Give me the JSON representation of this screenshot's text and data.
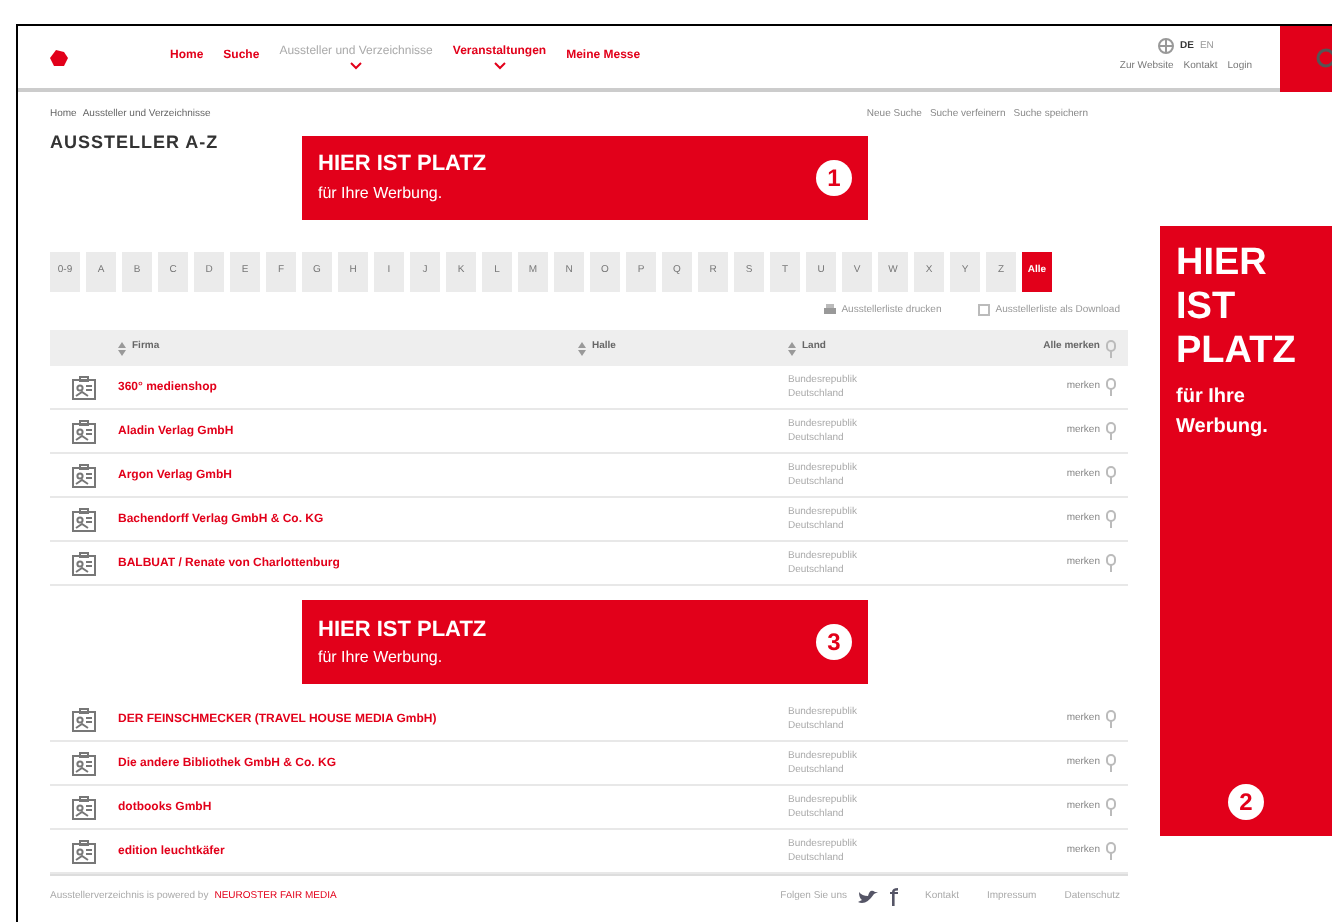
{
  "header": {
    "nav": [
      {
        "label": "Home",
        "selected": false,
        "dropdown": false
      },
      {
        "label": "Suche",
        "selected": false,
        "dropdown": false
      },
      {
        "label": "Aussteller und Verzeichnisse",
        "selected": true,
        "dropdown": true
      },
      {
        "label": "Veranstaltungen",
        "selected": false,
        "dropdown": true
      },
      {
        "label": "Meine Messe",
        "selected": false,
        "dropdown": false
      }
    ],
    "languages": [
      {
        "label": "DE",
        "selected": true
      },
      {
        "label": "EN",
        "selected": false
      }
    ],
    "links": [
      "Zur Website",
      "Kontakt",
      "Login"
    ]
  },
  "breadcrumb": [
    "Home",
    "Aussteller und Verzeichnisse"
  ],
  "search_links": [
    "Neue Suche",
    "Suche verfeinern",
    "Suche speichern"
  ],
  "title": "AUSSTELLER A-Z",
  "ads": [
    {
      "headline": "HIER IST PLATZ",
      "sub": "für Ihre Werbung.",
      "number": "1"
    },
    {
      "headline": "HIER IST PLATZ",
      "sub": "für Ihre Werbung.",
      "number": "2"
    }
  ],
  "letters": [
    {
      "label": "0-9",
      "selected": false
    },
    {
      "label": "A",
      "selected": false
    },
    {
      "label": "B",
      "selected": false
    },
    {
      "label": "C",
      "selected": false
    },
    {
      "label": "D",
      "selected": false
    },
    {
      "label": "E",
      "selected": false
    },
    {
      "label": "F",
      "selected": false
    },
    {
      "label": "G",
      "selected": false
    },
    {
      "label": "H",
      "selected": false
    },
    {
      "label": "I",
      "selected": false
    },
    {
      "label": "J",
      "selected": false
    },
    {
      "label": "K",
      "selected": false
    },
    {
      "label": "L",
      "selected": false
    },
    {
      "label": "M",
      "selected": false
    },
    {
      "label": "N",
      "selected": false
    },
    {
      "label": "O",
      "selected": false
    },
    {
      "label": "P",
      "selected": false
    },
    {
      "label": "Q",
      "selected": false
    },
    {
      "label": "R",
      "selected": false
    },
    {
      "label": "S",
      "selected": false
    },
    {
      "label": "T",
      "selected": false
    },
    {
      "label": "U",
      "selected": false
    },
    {
      "label": "V",
      "selected": false
    },
    {
      "label": "W",
      "selected": false
    },
    {
      "label": "X",
      "selected": false
    },
    {
      "label": "Y",
      "selected": false
    },
    {
      "label": "Z",
      "selected": false
    },
    {
      "label": "Alle",
      "selected": true
    }
  ],
  "options": {
    "print": "Ausstellerliste drucken",
    "checkbox": {
      "label": "Ausstellerliste als Download",
      "checked": false
    }
  },
  "table": {
    "columns": [
      "Firma",
      "Halle",
      "Land",
      "Alle merken"
    ],
    "rows": [
      {
        "kind": "row",
        "firma": "360° medienshop",
        "land": "Bundesrepublik Deutschland",
        "action": "merken"
      },
      {
        "kind": "row",
        "firma": "Aladin Verlag GmbH",
        "land": "Bundesrepublik Deutschland",
        "action": "merken"
      },
      {
        "kind": "row",
        "firma": "Argon Verlag GmbH",
        "land": "Bundesrepublik Deutschland",
        "action": "merken"
      },
      {
        "kind": "row",
        "firma": "Bachendorff Verlag GmbH & Co. KG",
        "land": "Bundesrepublik Deutschland",
        "action": "merken"
      },
      {
        "kind": "row",
        "firma": "BALBUAT / Renate von Charlottenburg",
        "land": "Bundesrepublik Deutschland",
        "action": "merken"
      },
      {
        "kind": "ad",
        "headline": "HIER IST PLATZ",
        "sub": "für Ihre Werbung.",
        "number": "3"
      },
      {
        "kind": "row",
        "firma": "DER FEINSCHMECKER (TRAVEL HOUSE MEDIA GmbH)",
        "land": "Bundesrepublik Deutschland",
        "action": "merken"
      },
      {
        "kind": "row",
        "firma": "Die andere Bibliothek GmbH & Co. KG",
        "land": "Bundesrepublik Deutschland",
        "action": "merken"
      },
      {
        "kind": "row",
        "firma": "dotbooks GmbH",
        "land": "Bundesrepublik Deutschland",
        "action": "merken"
      },
      {
        "kind": "row",
        "firma": "edition leuchtkäfer",
        "land": "Bundesrepublik Deutschland",
        "action": "merken"
      }
    ]
  },
  "footer": {
    "powered": "Ausstellerverzeichnis is powered by",
    "brand": "NEUROSTER FAIR MEDIA",
    "follow": "Folgen Sie uns",
    "links": [
      "Kontakt",
      "Impressum",
      "Datenschutz"
    ]
  }
}
